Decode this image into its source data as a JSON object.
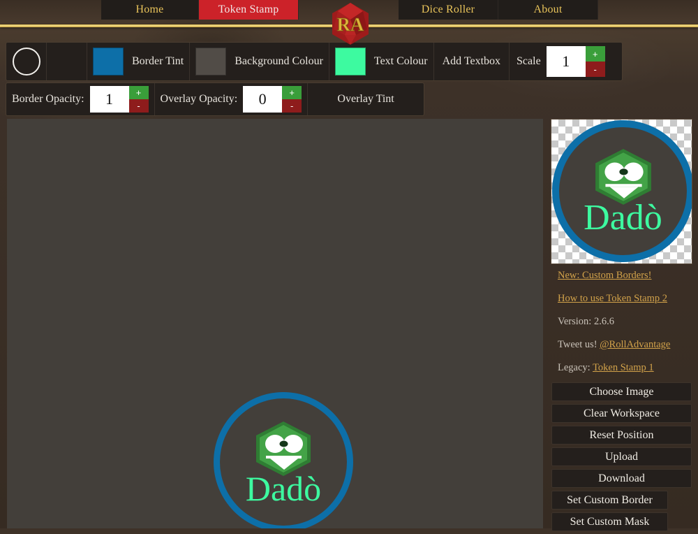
{
  "site": {
    "logo_icon": "d20-die-icon",
    "logo_text": "RA"
  },
  "nav": {
    "items": [
      {
        "label": "Home",
        "active": false
      },
      {
        "label": "Token Stamp",
        "active": true
      },
      {
        "label": "Dice Roller",
        "active": false
      },
      {
        "label": "About",
        "active": false
      }
    ]
  },
  "toolbar_top": {
    "shape_icon": "circle-shape-icon",
    "border_tint": {
      "label": "Border Tint",
      "color": "#0d6fa8"
    },
    "background_colour": {
      "label": "Background Colour",
      "color": "#514c47"
    },
    "text_colour": {
      "label": "Text Colour",
      "color": "#3dfaa0"
    },
    "add_textbox": "Add Textbox",
    "scale": {
      "label": "Scale",
      "value": "1",
      "plus": "+",
      "minus": "-"
    }
  },
  "toolbar_bottom": {
    "border_opacity": {
      "label": "Border Opacity:",
      "value": "1",
      "plus": "+",
      "minus": "-"
    },
    "overlay_opacity": {
      "label": "Overlay Opacity:",
      "value": "0",
      "plus": "+",
      "minus": "-"
    },
    "overlay_tint": "Overlay Tint"
  },
  "token": {
    "text": "Dadò",
    "text_color": "#3dfaa0",
    "border_color": "#0d6fa8",
    "background_color": "#433f3a",
    "face_color": "#3a9e3f"
  },
  "sidebar": {
    "links": [
      {
        "text": "New: Custom Borders!",
        "is_link": true
      },
      {
        "text": "How to use Token Stamp 2",
        "is_link": true
      }
    ],
    "version_label": "Version: 2.6.6",
    "tweet_prefix": "Tweet us! ",
    "tweet_handle": "@RollAdvantage",
    "legacy_prefix": "Legacy: ",
    "legacy_link": "Token Stamp 1",
    "actions": [
      "Choose Image",
      "Clear Workspace",
      "Reset Position",
      "Upload",
      "Download",
      "Set Custom Border",
      "Set Custom Mask"
    ]
  }
}
